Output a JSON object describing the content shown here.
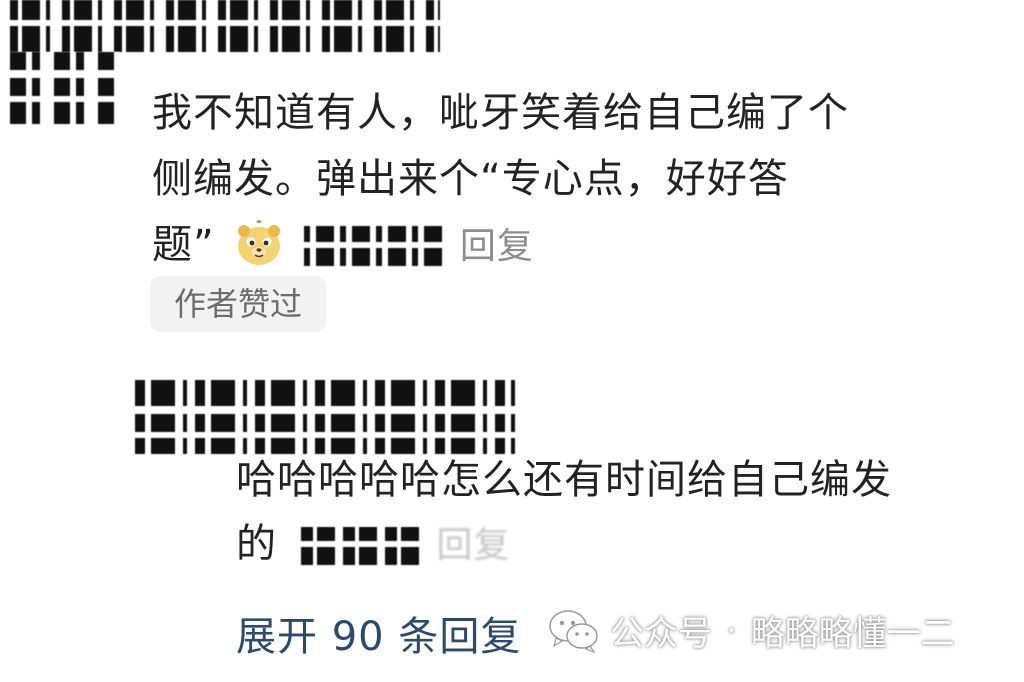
{
  "comment": {
    "text_line1": "我不知道有人，呲牙笑着给自己编了个",
    "text_line2": "侧编发。弹出来个“专心点，好好答",
    "text_line3": "题”",
    "emoji": "bear-face-emoji",
    "reply_label": "回复",
    "author_liked_badge": "作者赞过"
  },
  "nested_reply": {
    "text_line1": "哈哈哈哈哈怎么还有时间给自己编发",
    "text_line2": "的",
    "reply_label": "回复"
  },
  "expand_replies": {
    "label": "展开 90 条回复"
  },
  "watermark": {
    "icon": "wechat-icon",
    "platform": "公众号",
    "separator": "·",
    "account": "略略略懂一二"
  },
  "colors": {
    "text": "#222222",
    "muted": "#8e8e8e",
    "badge_bg": "#f2f2f2",
    "link": "#2b4a6f"
  }
}
